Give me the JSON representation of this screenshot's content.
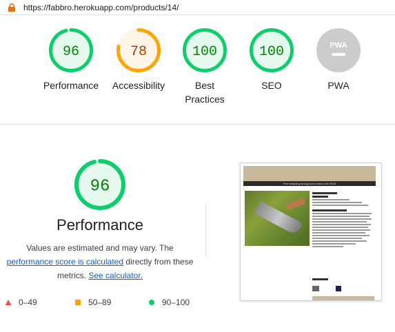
{
  "url_bar": {
    "icon": "lock-icon",
    "url": "https://fabbro.herokuapp.com/products/14/"
  },
  "colors": {
    "pass": "#0cce6b",
    "pass_fill": "#e6f9ee",
    "pass_text": "#008800",
    "average": "#ffa400",
    "average_fill": "#fff5e6",
    "average_text": "#c33300",
    "fail": "#ff4e42",
    "na": "#cccccc",
    "link": "#1a5dc9"
  },
  "gauges": [
    {
      "score": "96",
      "label_lines": [
        "Performance"
      ],
      "rating": "pass",
      "fraction": 0.96
    },
    {
      "score": "78",
      "label_lines": [
        "Accessibility"
      ],
      "rating": "average",
      "fraction": 0.78
    },
    {
      "score": "100",
      "label_lines": [
        "Best",
        "Practices"
      ],
      "rating": "pass",
      "fraction": 1.0
    },
    {
      "score": "100",
      "label_lines": [
        "SEO"
      ],
      "rating": "pass",
      "fraction": 1.0
    },
    {
      "score": "",
      "label_lines": [
        "PWA"
      ],
      "rating": "na",
      "badge_text": "PWA"
    }
  ],
  "performance": {
    "score": "96",
    "fraction": 0.96,
    "title": "Performance",
    "desc_1": "Values are estimated and may vary. The",
    "link_1": "performance score is calculated",
    "desc_2": "directly from these metrics.",
    "link_2": "See calculator."
  },
  "legend": [
    {
      "icon": "triangle-icon",
      "range": "0–49",
      "color": "#ff4e42"
    },
    {
      "icon": "square-icon",
      "range": "50–89",
      "color": "#ffa400"
    },
    {
      "icon": "circle-icon",
      "range": "90–100",
      "color": "#0cce6b"
    }
  ],
  "screenshot": {
    "banner": "Free shipping throughout Ireland over €100",
    "product_title": "Machete 13\"",
    "price": "300.00",
    "section": "Product Description:",
    "quantity": "Quantity"
  }
}
